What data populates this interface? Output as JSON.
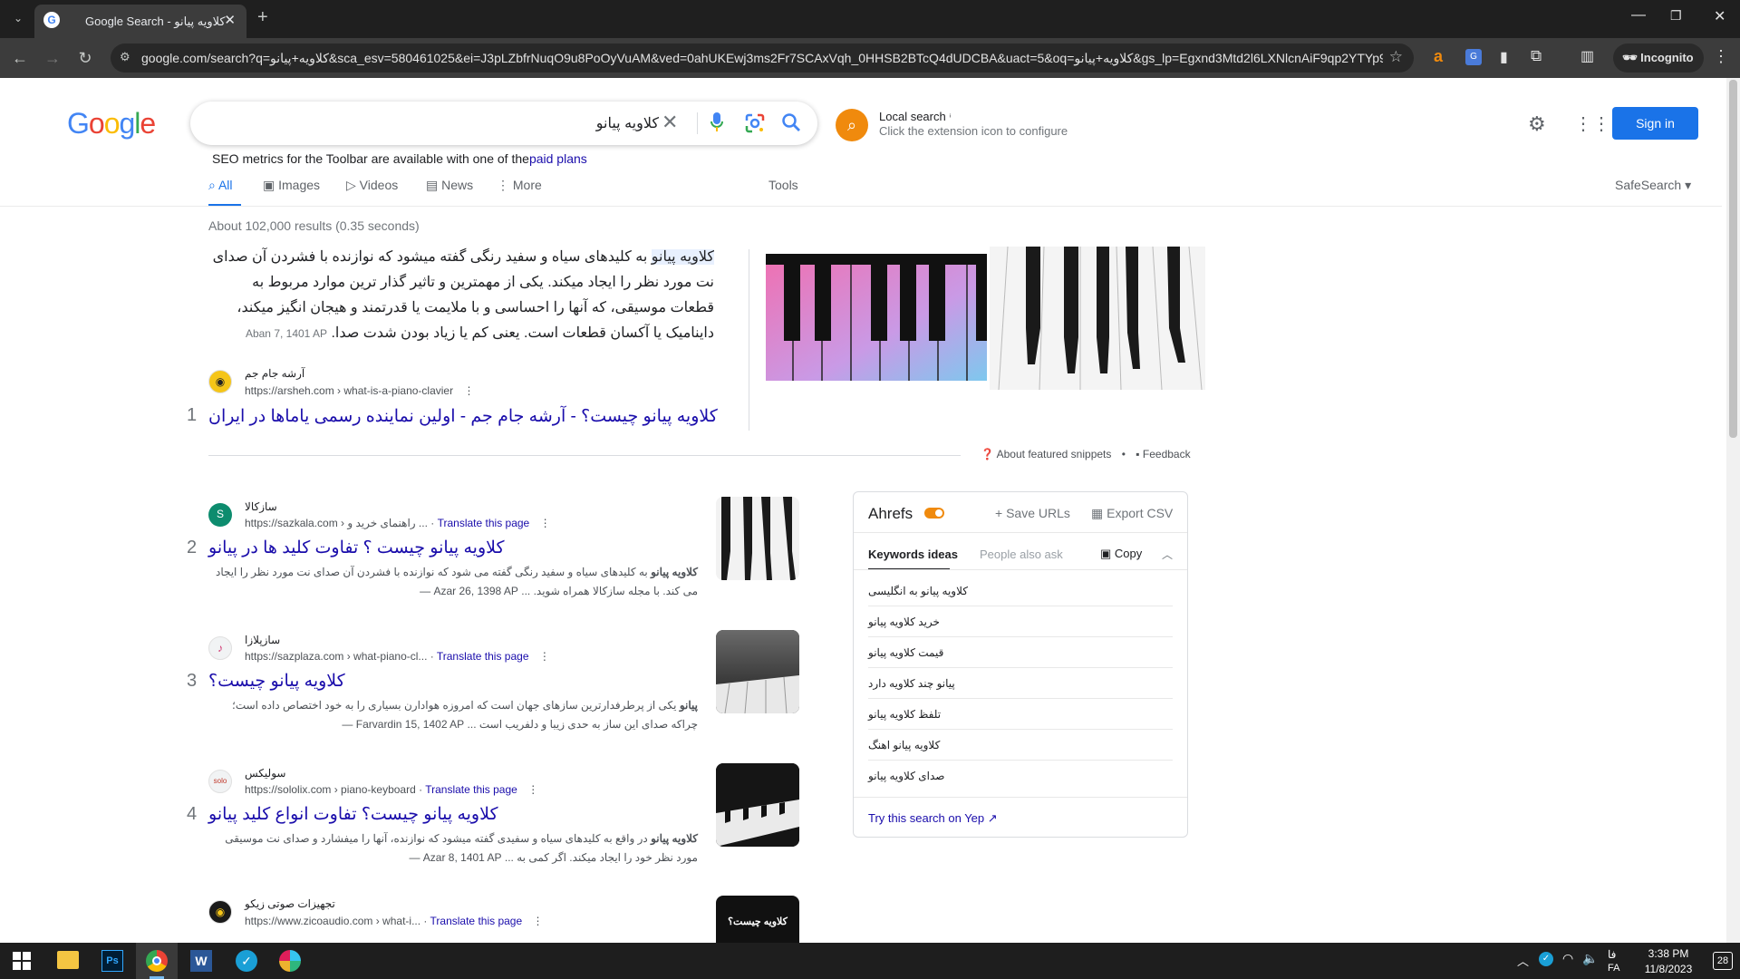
{
  "browser": {
    "tab_title": "کلاویه پیانو - Google Search",
    "url": "google.com/search?q=کلاویه+پیانو&sca_esv=580461025&ei=J3pLZbfrNuqO9u8PoOyVuAM&ved=0ahUKEwj3ms2Fr7SCAxVqh_0HHSB2BTcQ4dUDCBA&uact=5&oq=کلاویه+پیانو&gs_lp=Egxnd3Mtd2l6LXNlcnAiF9qp2YTYp9...",
    "incognito_label": "Incognito"
  },
  "header": {
    "query": "کلاویه پیانو",
    "local_search_title": "Local search",
    "local_search_sub": "Click the extension icon to configure",
    "sign_in": "Sign in",
    "seo_text": "SEO metrics for the Toolbar are available with one of the",
    "seo_link": "paid plans"
  },
  "nav": {
    "all": "All",
    "images": "Images",
    "videos": "Videos",
    "news": "News",
    "more": "More",
    "tools": "Tools",
    "safesearch": "SafeSearch"
  },
  "stats": "About 102,000 results (0.35 seconds)",
  "featured": {
    "highlight": "کلاویه پیانو",
    "text": " به کلیدهای سیاه و سفید رنگی گفته میشود که نوازنده با فشردن آن صدای نت مورد نظر را ایجاد میکند. یکی از مهمترین و تاثیر گذار ترین موارد مربوط به قطعات موسیقی، که آنها را احساسی و با ملایمت یا قدرتمند و هیجان انگیز میکند، داینامیک یا آکسان قطعات است. یعنی کم یا زیاد بودن شدت صدا.",
    "date": "Aban 7, 1401 AP",
    "site": "آرشه جام جم",
    "url": "https://arsheh.com › what-is-a-piano-clavier",
    "title": "کلاویه پیانو چیست؟ - آرشه جام جم - اولین نماینده رسمی یاماها در ایران",
    "number": "1",
    "about": "About featured snippets",
    "feedback": "Feedback"
  },
  "results": [
    {
      "number": "2",
      "site": "سازکالا",
      "url": "https://sazkala.com › راهنمای خرید و ...",
      "translate": "Translate this page",
      "title": "کلاویه پیانو چیست ؟ تفاوت کلید ها در پیانو",
      "date": "Azar 26, 1398 AP —",
      "desc_bold": "کلاویه پیانو",
      "desc": " به کلیدهای سیاه و سفید رنگی گفته می شود که نوازنده با فشردن آن صدای نت مورد نظر را ایجاد می کند. با مجله سازکالا همراه شوید. ..."
    },
    {
      "number": "3",
      "site": "سازپلازا",
      "url": "https://sazplaza.com › what-piano-cl...",
      "translate": "Translate this page",
      "title": "کلاویه پیانو چیست؟",
      "date": "Farvardin 15, 1402 AP —",
      "desc_bold": "پیانو",
      "desc": " یکی از پرطرفدارترین سازهای جهان است که امروزه هوادارن بسیاری را به خود اختصاص داده است؛ چراکه صدای این ساز به حدی زیبا و دلفریب است ..."
    },
    {
      "number": "4",
      "site": "سولیکس",
      "url": "https://sololix.com › piano-keyboard",
      "translate": "Translate this page",
      "title": "کلاویه پیانو چیست؟ تفاوت انواع کلید پیانو",
      "date": "Azar 8, 1401 AP —",
      "desc_bold": "کلاویه پیانو",
      "desc": " در واقع به کلیدهای سیاه و سفیدی گفته میشود که نوازنده، آنها را میفشارد و صدای نت موسیقی مورد نظر خود را ایجاد میکند. اگر کمی به ..."
    },
    {
      "number": "5",
      "site": "تجهیزات صوتی زیکو",
      "url": "https://www.zicoaudio.com › what-i...",
      "translate": "Translate this page",
      "title": "",
      "date": "",
      "desc_bold": "",
      "desc": ""
    }
  ],
  "ahrefs": {
    "title": "Ahrefs",
    "save": "Save URLs",
    "export": "Export CSV",
    "tab_keywords": "Keywords ideas",
    "tab_paa": "People also ask",
    "copy": "Copy",
    "keywords": [
      "کلاویه پیانو به انگلیسی",
      "خرید کلاویه پیانو",
      "قیمت کلاویه پیانو",
      "پیانو چند کلاویه دارد",
      "تلفظ کلاویه پیانو",
      "کلاویه پیانو اهنگ",
      "صدای کلاویه پیانو"
    ],
    "yep": "Try this search on Yep"
  },
  "thumb5_text": "کلاویه چیست؟",
  "taskbar": {
    "lang": "فا",
    "lang2": "FA",
    "time": "3:38 PM",
    "date": "11/8/2023",
    "badge": "28"
  }
}
